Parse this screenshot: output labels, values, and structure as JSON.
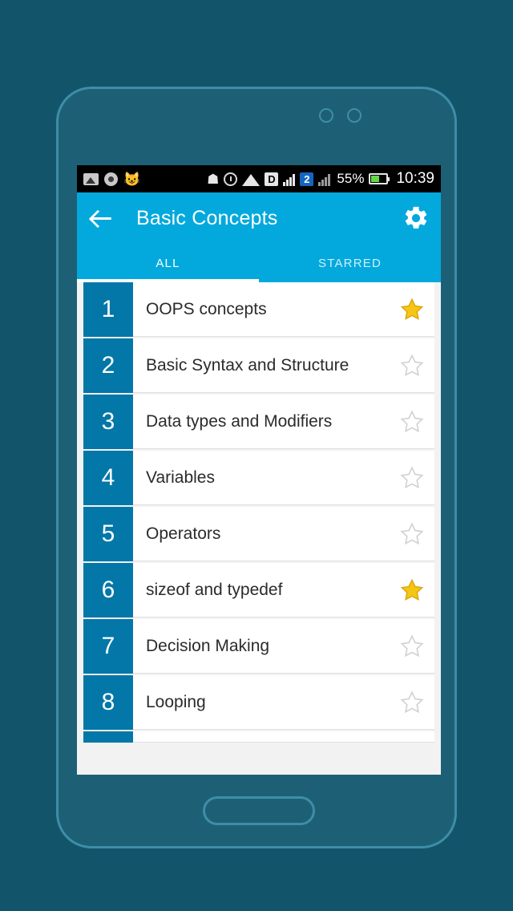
{
  "statusbar": {
    "icons": [
      "gallery-icon",
      "camera-icon",
      "cat-icon",
      "github-icon",
      "alarm-icon",
      "wifi-icon",
      "dnd-icon",
      "signal-icon",
      "sim2-icon",
      "signal2-icon"
    ],
    "sim_badge": "2",
    "dnd_badge": "D",
    "battery_percent": "55%",
    "clock": "10:39"
  },
  "appbar": {
    "back_label": "back-arrow",
    "title": "Basic Concepts",
    "settings_label": "settings"
  },
  "tabs": [
    {
      "label": "ALL",
      "active": true
    },
    {
      "label": "STARRED",
      "active": false
    }
  ],
  "list": {
    "items": [
      {
        "num": "1",
        "title": "OOPS concepts",
        "starred": true
      },
      {
        "num": "2",
        "title": "Basic Syntax and Structure",
        "starred": false
      },
      {
        "num": "3",
        "title": "Data types and Modifiers",
        "starred": false
      },
      {
        "num": "4",
        "title": "Variables",
        "starred": false
      },
      {
        "num": "5",
        "title": "Operators",
        "starred": false
      },
      {
        "num": "6",
        "title": "sizeof and typedef",
        "starred": true
      },
      {
        "num": "7",
        "title": "Decision Making",
        "starred": false
      },
      {
        "num": "8",
        "title": "Looping",
        "starred": false
      }
    ]
  },
  "colors": {
    "accent": "#03a9dc",
    "number_badge": "#0277a8",
    "star_on": "#f5c518",
    "star_off": "#d8d8d8",
    "page_bg": "#12556b",
    "phone_body": "#1d6075",
    "phone_border": "#3d8ea6"
  }
}
